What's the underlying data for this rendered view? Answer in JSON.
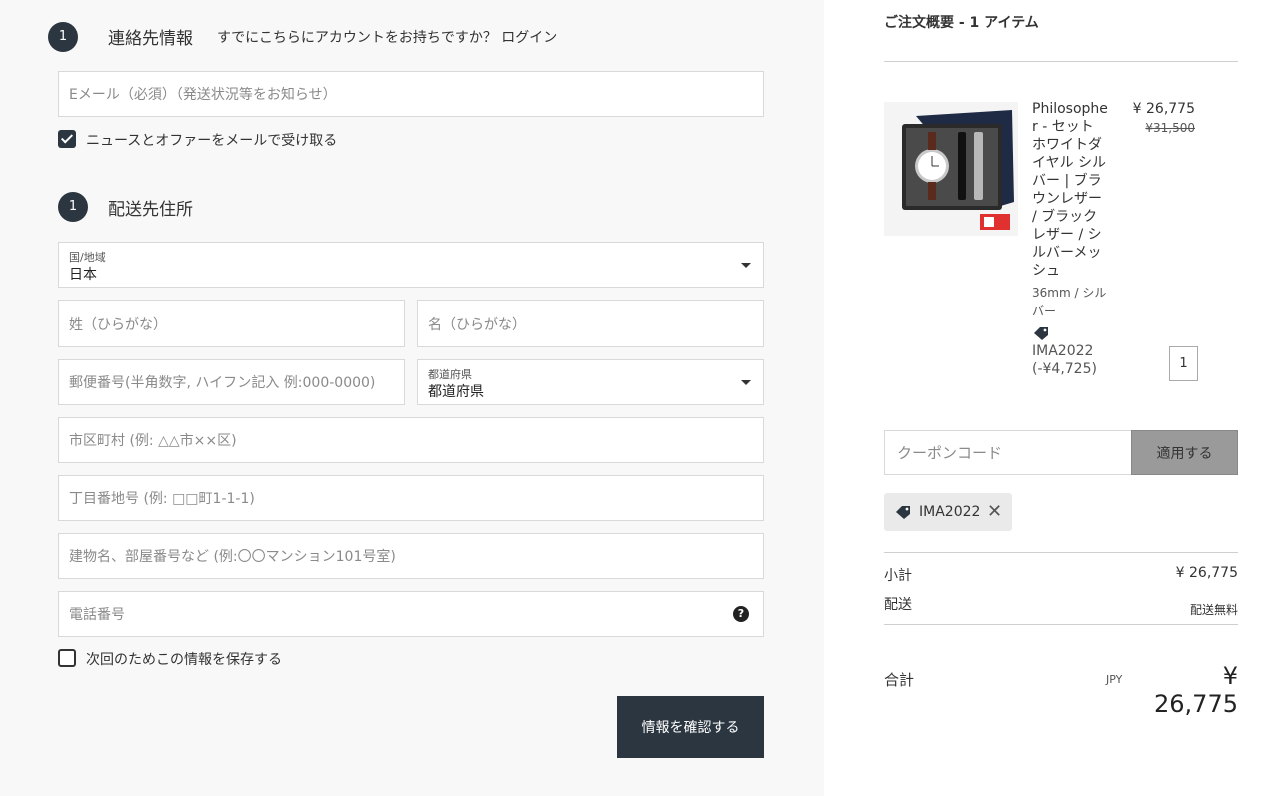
{
  "contact": {
    "step": "1",
    "title": "連絡先情報",
    "login_prompt": "すでにこちらにアカウントをお持ちですか？ ログイン",
    "email_placeholder": "Eメール（必須）（発送状況等をお知らせ）",
    "newsletter_label": "ニュースとオファーをメールで受け取る",
    "newsletter_checked": true
  },
  "shipping": {
    "step": "1",
    "title": "配送先住所",
    "country_label": "国/地域",
    "country_value": "日本",
    "last_name_placeholder": "姓（ひらがな）",
    "first_name_placeholder": "名（ひらがな）",
    "postal_placeholder": "郵便番号(半角数字, ハイフン記入 例:000-0000)",
    "prefecture_label": "都道府県",
    "prefecture_value": "都道府県",
    "city_placeholder": "市区町村 (例: △△市××区)",
    "address1_placeholder": "丁目番地号 (例: □□町1-1-1)",
    "address2_placeholder": "建物名、部屋番号など (例:〇〇マンション101号室)",
    "phone_placeholder": "電話番号",
    "save_info_label": "次回のためこの情報を保存する",
    "save_info_checked": false,
    "submit_label": "情報を確認する"
  },
  "summary": {
    "title": "ご注文概要 - 1 アイテム",
    "product_name": "Philosopher - セット ホワイトダイヤル シルバー | ブラウンレザー / ブラックレザー / シルバーメッシュ",
    "variant": "36mm / シルバー",
    "discount_code": "IMA2022",
    "discount_amount": "(-¥4,725)",
    "price": "¥ 26,775",
    "price_old": "¥31,500",
    "quantity": "1",
    "coupon_placeholder": "クーポンコード",
    "apply_label": "適用する",
    "applied_code": "IMA2022",
    "subtotal_label": "小計",
    "subtotal_value": "¥ 26,775",
    "shipping_label": "配送",
    "shipping_value": "配送無料",
    "total_label": "合計",
    "currency": "JPY",
    "total_value": "¥ 26,775"
  },
  "colors": {
    "dark": "#2b3640",
    "panel": "#f8f8f8",
    "apply_bg": "#9a9a9a"
  }
}
